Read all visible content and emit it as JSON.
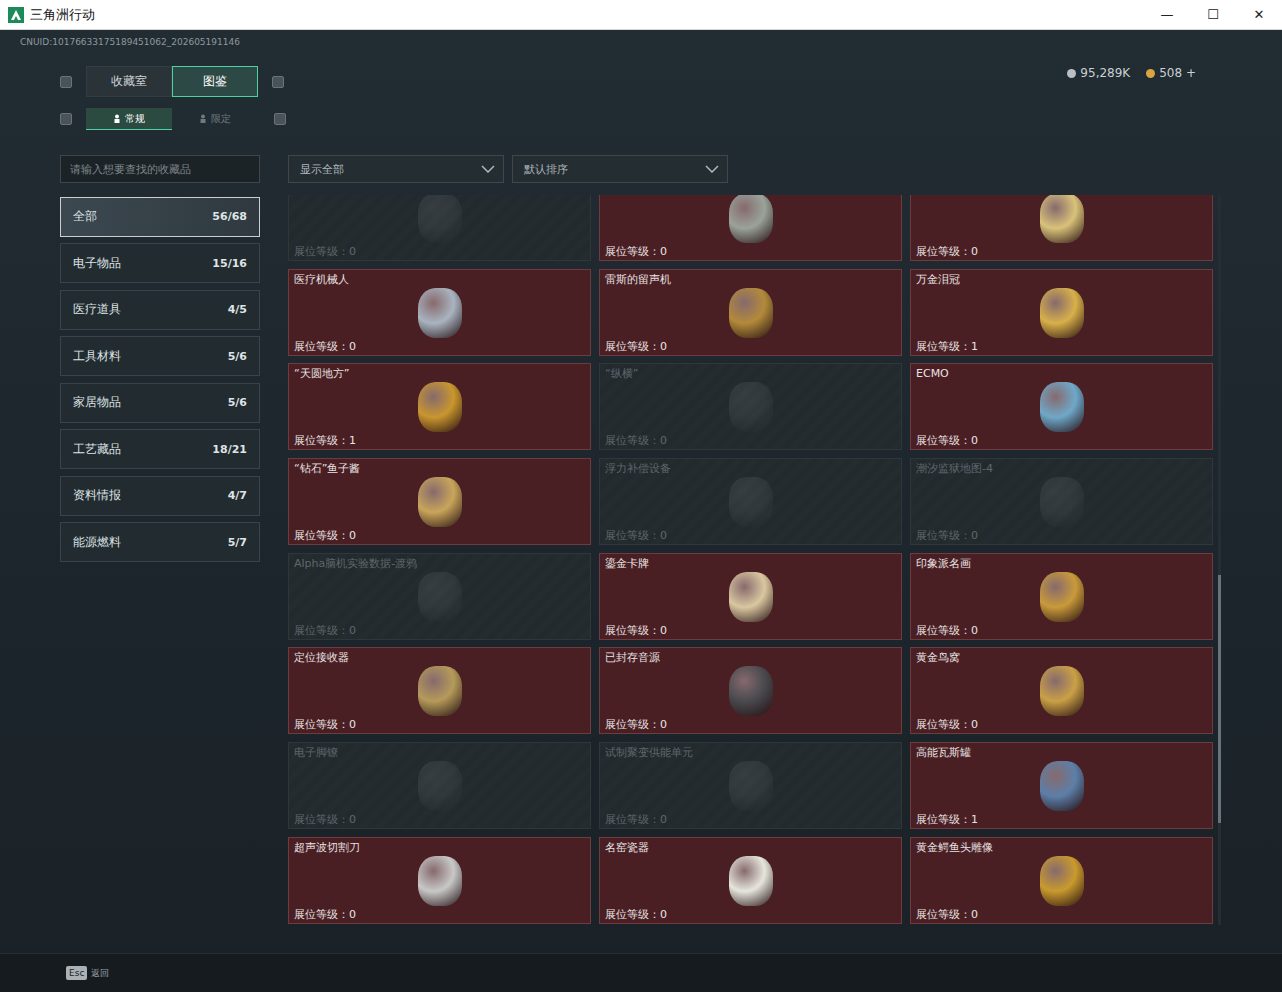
{
  "window": {
    "title": "三角洲行动",
    "controls": [
      "—",
      "☐",
      "✕"
    ]
  },
  "uid": "CNUID:10176633175189451062_202605191146",
  "tabs": [
    {
      "label": "收藏室",
      "selected": false
    },
    {
      "label": "图鉴",
      "selected": true
    }
  ],
  "subtabs": [
    {
      "label": "常规",
      "selected": true
    },
    {
      "label": "限定",
      "selected": false
    }
  ],
  "currency": [
    {
      "amount": "95,289K",
      "color": "#b9c0c4"
    },
    {
      "amount": "508 +",
      "color": "#d9a441"
    }
  ],
  "search": {
    "placeholder": "请输入想要查找的收藏品"
  },
  "filters": [
    "显示全部",
    "默认排序"
  ],
  "categories": [
    {
      "label": "全部",
      "count": "56/68",
      "selected": true
    },
    {
      "label": "电子物品",
      "count": "15/16",
      "selected": false
    },
    {
      "label": "医疗道具",
      "count": "4/5",
      "selected": false
    },
    {
      "label": "工具材料",
      "count": "5/6",
      "selected": false
    },
    {
      "label": "家居物品",
      "count": "5/6",
      "selected": false
    },
    {
      "label": "工艺藏品",
      "count": "18/21",
      "selected": false
    },
    {
      "label": "资料情报",
      "count": "4/7",
      "selected": false
    },
    {
      "label": "能源燃料",
      "count": "5/7",
      "selected": false
    }
  ],
  "items": [
    {
      "name": "",
      "level_text": "展位等级：0",
      "collected": false,
      "color": "#5a6065"
    },
    {
      "name": "",
      "level_text": "展位等级：0",
      "collected": true,
      "color": "#9aa39a"
    },
    {
      "name": "",
      "level_text": "展位等级：0",
      "collected": true,
      "color": "#d9c27a"
    },
    {
      "name": "医疗机械人",
      "level_text": "展位等级：0",
      "collected": true,
      "color": "#a9b4c0"
    },
    {
      "name": "雷斯的留声机",
      "level_text": "展位等级：0",
      "collected": true,
      "color": "#b38a3a"
    },
    {
      "name": "万金泪冠",
      "level_text": "展位等级：1",
      "collected": true,
      "color": "#d8b04a"
    },
    {
      "name": "“天圆地方”",
      "level_text": "展位等级：1",
      "collected": true,
      "color": "#c9962e"
    },
    {
      "name": "“纵横”",
      "level_text": "展位等级：0",
      "collected": false,
      "color": "#5a6065"
    },
    {
      "name": "ECMO",
      "level_text": "展位等级：0",
      "collected": true,
      "color": "#6fa8c8"
    },
    {
      "name": "“钻石”鱼子酱",
      "level_text": "展位等级：0",
      "collected": true,
      "color": "#c9a55a"
    },
    {
      "name": "浮力补偿设备",
      "level_text": "展位等级：0",
      "collected": false,
      "color": "#5a6065"
    },
    {
      "name": "潮汐监狱地图-4",
      "level_text": "展位等级：0",
      "collected": false,
      "color": "#5a6065"
    },
    {
      "name": "Alpha脑机实验数据-渡鸦",
      "level_text": "展位等级：0",
      "collected": false,
      "color": "#5a6065"
    },
    {
      "name": "鎏金卡牌",
      "level_text": "展位等级：0",
      "collected": true,
      "color": "#d9c7a0"
    },
    {
      "name": "印象派名画",
      "level_text": "展位等级：0",
      "collected": true,
      "color": "#c99a3a"
    },
    {
      "name": "定位接收器",
      "level_text": "展位等级：0",
      "collected": true,
      "color": "#b59a5a"
    },
    {
      "name": "已封存音源",
      "level_text": "展位等级：0",
      "collected": true,
      "color": "#4a4a4e"
    },
    {
      "name": "黄金鸟窝",
      "level_text": "展位等级：0",
      "collected": true,
      "color": "#caa046"
    },
    {
      "name": "电子脚镣",
      "level_text": "展位等级：0",
      "collected": false,
      "color": "#5a6065"
    },
    {
      "name": "试制聚变供能单元",
      "level_text": "展位等级：0",
      "collected": false,
      "color": "#5a6065"
    },
    {
      "name": "高能瓦斯罐",
      "level_text": "展位等级：1",
      "collected": true,
      "color": "#5d7fa8"
    },
    {
      "name": "超声波切割刀",
      "level_text": "展位等级：0",
      "collected": true,
      "color": "#c8c8c8"
    },
    {
      "name": "名窑瓷器",
      "level_text": "展位等级：0",
      "collected": true,
      "color": "#e6e6dc"
    },
    {
      "name": "黄金鳄鱼头雕像",
      "level_text": "展位等级：0",
      "collected": true,
      "color": "#c99a2e"
    }
  ],
  "scrollbar": {
    "level": 0.34,
    "offset": 0.52
  },
  "footer": {
    "key": "Esc",
    "label": "返回"
  }
}
